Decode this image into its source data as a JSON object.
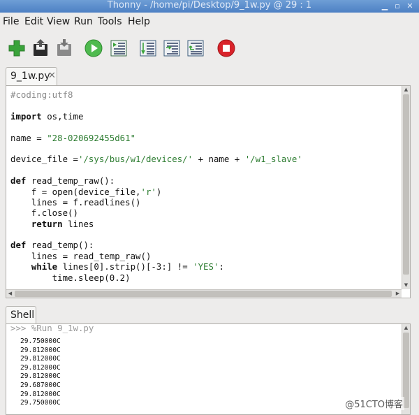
{
  "window": {
    "title": "Thonny  -  /home/pi/Desktop/9_1w.py  @  29 : 1"
  },
  "menu": [
    "File",
    "Edit",
    "View",
    "Run",
    "Tools",
    "Help"
  ],
  "toolbar": {
    "icons": [
      "new-file-icon",
      "open-file-icon",
      "save-file-icon",
      "run-icon",
      "debug-icon",
      "step-over-icon",
      "step-into-icon",
      "step-out-icon",
      "stop-icon"
    ],
    "colors": {
      "green": "#3aa33a",
      "stop": "#d9232a"
    }
  },
  "editor": {
    "tab": {
      "label": "9_1w.py",
      "close": "✕"
    },
    "lines": [
      [
        [
          "cmt",
          "#coding:utf8"
        ]
      ],
      [],
      [
        [
          "kw",
          "import"
        ],
        [
          "",
          " os,time"
        ]
      ],
      [],
      [
        [
          "",
          "name = "
        ],
        [
          "str",
          "\"28-020692455d61\""
        ]
      ],
      [],
      [
        [
          "",
          "device_file ="
        ],
        [
          "str",
          "'/sys/bus/w1/devices/'"
        ],
        [
          "",
          " + name + "
        ],
        [
          "str",
          "'/w1_slave'"
        ]
      ],
      [],
      [
        [
          "kw",
          "def"
        ],
        [
          "",
          " read_temp_raw():"
        ]
      ],
      [
        [
          "",
          "    f = open(device_file,"
        ],
        [
          "str",
          "'r'"
        ],
        [
          "",
          ")"
        ]
      ],
      [
        [
          "",
          "    lines = f.readlines()"
        ]
      ],
      [
        [
          "",
          "    f.close()"
        ]
      ],
      [
        [
          "",
          "    "
        ],
        [
          "kw",
          "return"
        ],
        [
          "",
          " lines"
        ]
      ],
      [],
      [
        [
          "kw",
          "def"
        ],
        [
          "",
          " read_temp():"
        ]
      ],
      [
        [
          "",
          "    lines = read_temp_raw()"
        ]
      ],
      [
        [
          "",
          "    "
        ],
        [
          "kw",
          "while"
        ],
        [
          "",
          " lines[0].strip()[-3:] != "
        ],
        [
          "str",
          "'YES'"
        ],
        [
          "",
          ":"
        ]
      ],
      [
        [
          "",
          "        time.sleep(0.2)"
        ]
      ]
    ]
  },
  "shell": {
    "tab": "Shell",
    "command": ">>> %Run 9_1w.py",
    "output": [
      "29.750000C",
      "29.812000C",
      "29.812000C",
      "29.812000C",
      "29.812000C",
      "29.687000C",
      "29.812000C",
      "29.750000C"
    ]
  },
  "watermark": "@51CTO博客"
}
